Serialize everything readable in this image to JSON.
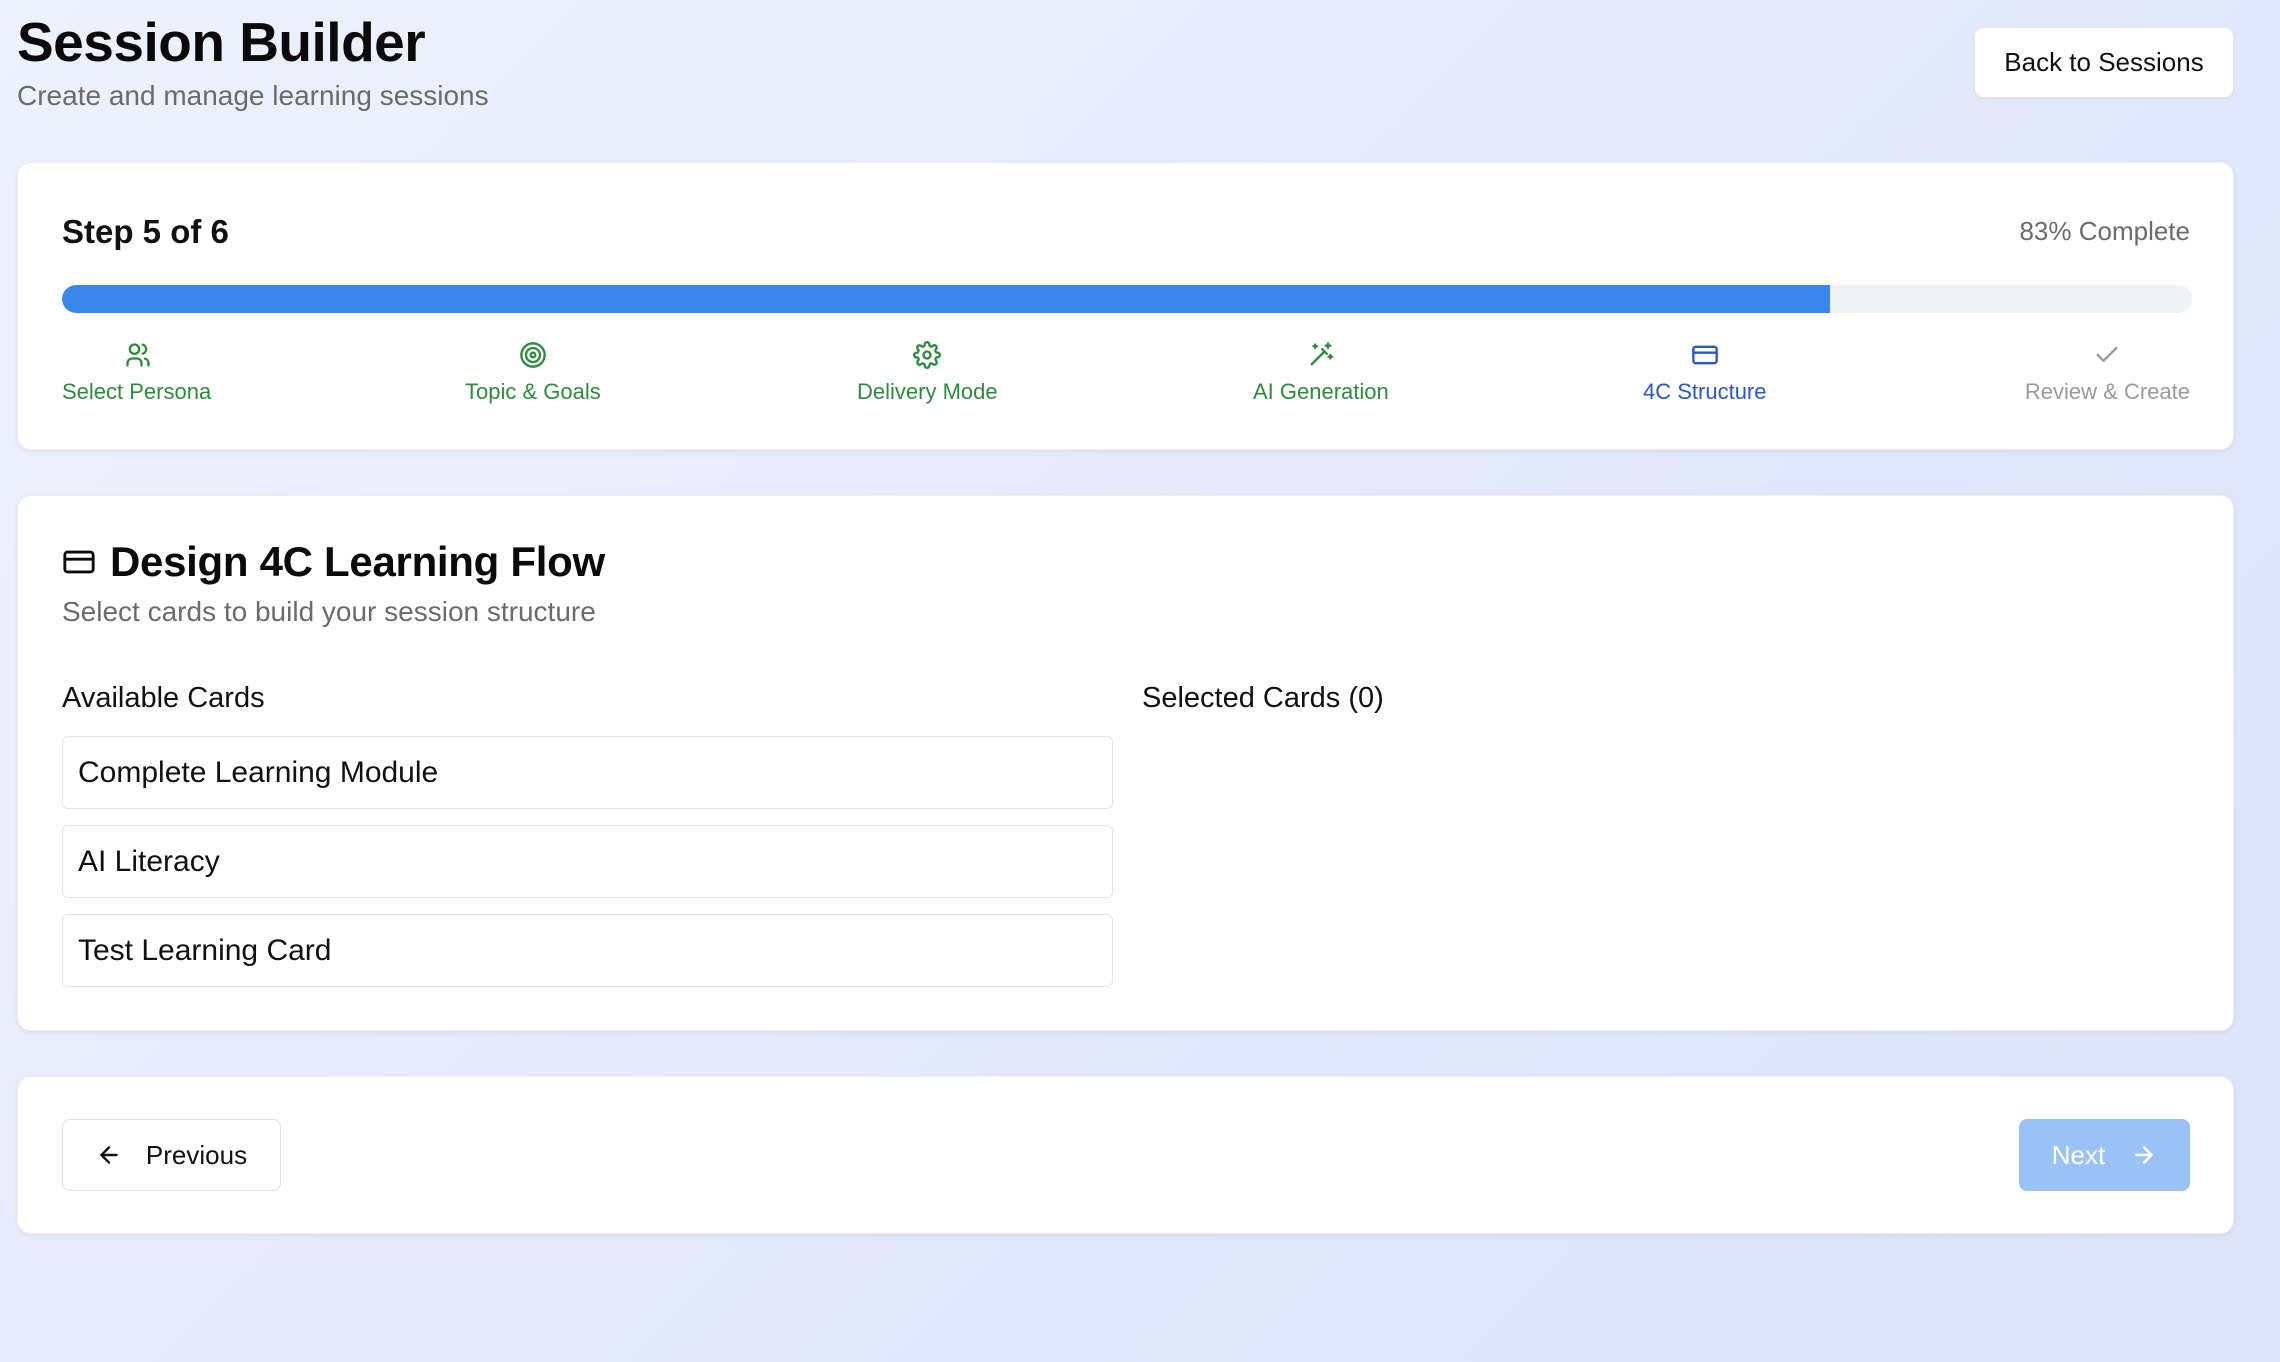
{
  "header": {
    "title": "Session Builder",
    "subtitle": "Create and manage learning sessions",
    "back_label": "Back to Sessions"
  },
  "progress": {
    "step_text": "Step 5 of 6",
    "percent_text": "83% Complete",
    "percent_value": 83,
    "steps": [
      {
        "label": "Select Persona",
        "icon": "users-icon",
        "state": "done"
      },
      {
        "label": "Topic & Goals",
        "icon": "target-icon",
        "state": "done"
      },
      {
        "label": "Delivery Mode",
        "icon": "gear-icon",
        "state": "done"
      },
      {
        "label": "AI Generation",
        "icon": "magic-wand-icon",
        "state": "done"
      },
      {
        "label": "4C Structure",
        "icon": "card-icon",
        "state": "active"
      },
      {
        "label": "Review & Create",
        "icon": "check-icon",
        "state": "pending"
      }
    ]
  },
  "flow": {
    "title": "Design 4C Learning Flow",
    "subtitle": "Select cards to build your session structure",
    "available_heading": "Available Cards",
    "selected_heading": "Selected Cards (0)",
    "available_cards": [
      "Complete Learning Module",
      "AI Literacy",
      "Test Learning Card"
    ]
  },
  "nav": {
    "previous_label": "Previous",
    "next_label": "Next"
  },
  "colors": {
    "progress_fill": "#3a86ec",
    "done": "#2f8a3e",
    "active": "#2b55c9",
    "pending": "#9a9a9a",
    "next_disabled": "#9bc2f4"
  }
}
